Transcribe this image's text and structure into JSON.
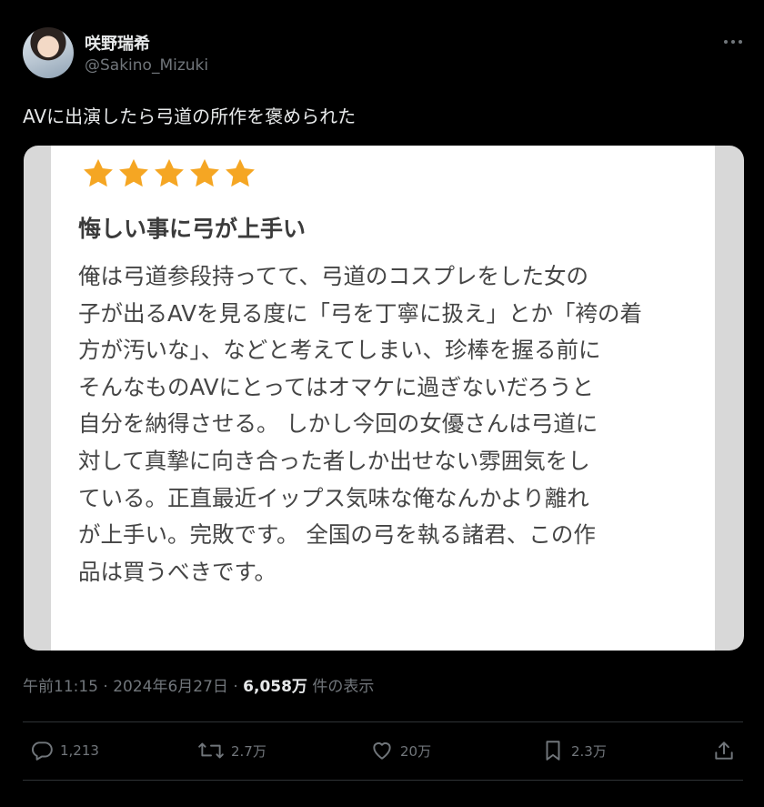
{
  "author": {
    "display_name": "咲野瑞希",
    "handle": "@Sakino_Mizuki"
  },
  "tweet": {
    "text": "AVに出演したら弓道の所作を褒められた"
  },
  "review_image": {
    "rating": 5,
    "title": "悔しい事に弓が上手い",
    "body_lines": [
      "俺は弓道参段持ってて、弓道のコスプレをした女の",
      "子が出るAVを見る度に「弓を丁寧に扱え」とか「袴の着",
      "方が汚いな」、などと考えてしまい、珍棒を握る前に",
      "そんなものAVにとってはオマケに過ぎないだろうと",
      "自分を納得させる。 しかし今回の女優さんは弓道に",
      "対して真摯に向き合った者しか出せない雰囲気をし",
      "ている。正直最近イップス気味な俺なんかより離れ",
      "が上手い。完敗です。 全国の弓を執る諸君、この作",
      "品は買うべきです。"
    ]
  },
  "meta": {
    "time": "午前11:15",
    "separator": "·",
    "date": "2024年6月27日",
    "views": "6,058万",
    "views_label": "件の表示"
  },
  "actions": {
    "replies": "1,213",
    "reposts": "2.7万",
    "likes": "20万",
    "bookmarks": "2.3万"
  },
  "colors": {
    "background": "#000000",
    "text": "#e7e9ea",
    "muted": "#71767b",
    "star": "#f5a623"
  }
}
